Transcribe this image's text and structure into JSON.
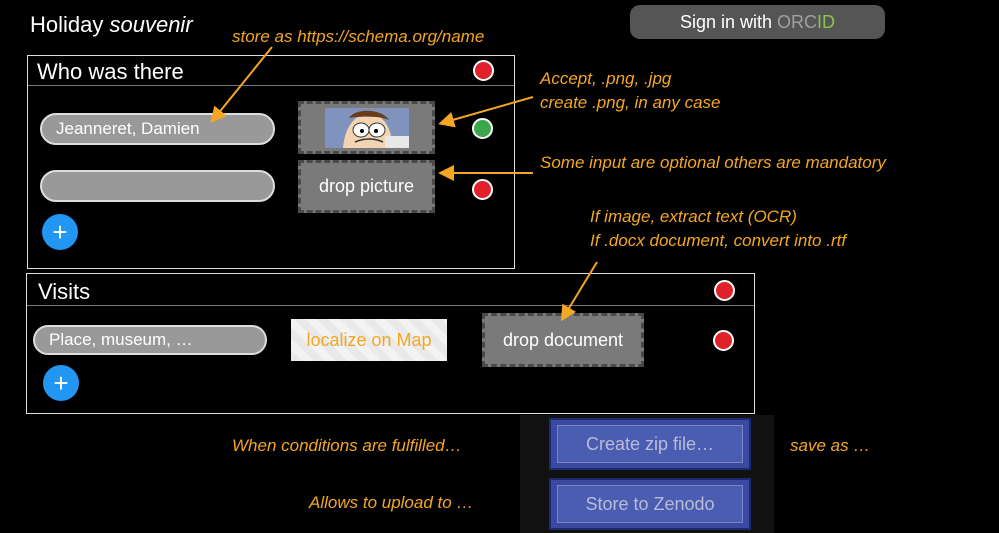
{
  "header": {
    "title_main": "Holiday ",
    "title_italic": "souvenir",
    "signin_prefix": "Sign in with ",
    "signin_orc": "ORC",
    "signin_id": "ID"
  },
  "who": {
    "title": "Who was there",
    "rows": [
      {
        "value": "Jeanneret, Damien",
        "status": "green"
      },
      {
        "value": "",
        "drop_label": "drop picture",
        "status": "red"
      }
    ],
    "header_status": "red"
  },
  "visits": {
    "title": "Visits",
    "place_placeholder": "Place, museum, …",
    "map_label": "localize on Map",
    "drop_label": "drop document",
    "header_status": "red",
    "row_status": "red"
  },
  "actions": {
    "zip_label": "Create zip file…",
    "zenodo_label": "Store to Zenodo"
  },
  "annotations": {
    "schema": "store as https://schema.org/name",
    "accept_1": "Accept, .png, .jpg",
    "accept_2": "create .png, in any case",
    "optional": "Some input are optional others are mandatory",
    "ocr_1": "If image, extract text (OCR)",
    "ocr_2": "If .docx document, convert into .rtf",
    "conditions": "When conditions are fulfilled…",
    "save_as": "save as …",
    "upload": "Allows to upload to …"
  },
  "icons": {
    "add": "plus-icon",
    "status": "status-dot-icon",
    "avatar": "cartoon-avatar-thumbnail"
  },
  "colors": {
    "accent_orange": "#f5a623",
    "status_red": "#e0202a",
    "status_green": "#3aa84a",
    "add_blue": "#2196f3"
  }
}
